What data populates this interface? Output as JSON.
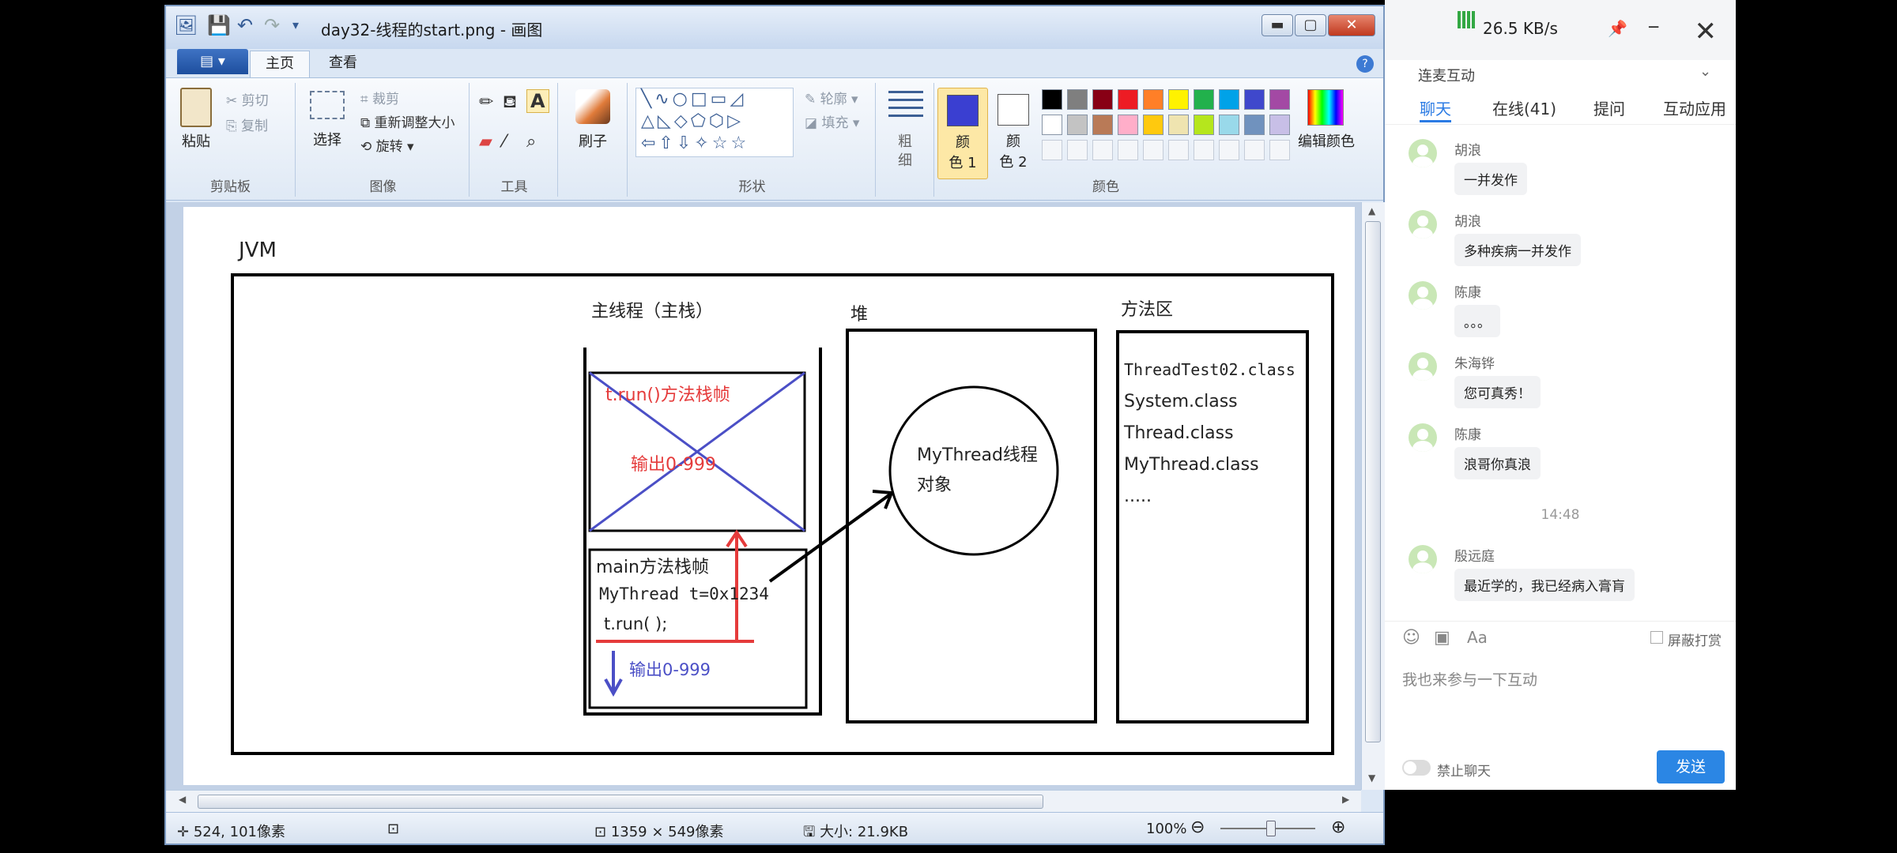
{
  "window": {
    "title": "day32-线程的start.png - 画图",
    "min": "▬",
    "max": "▢",
    "close": "✕"
  },
  "tabs": {
    "file": "▤ ▾",
    "home": "主页",
    "view": "查看",
    "help": "?"
  },
  "ribbon": {
    "clipboard": {
      "paste": "粘贴",
      "cut": "剪切",
      "copy": "复制",
      "label": "剪贴板"
    },
    "image": {
      "select": "选择",
      "crop": "裁剪",
      "resize": "重新调整大小",
      "rotate": "旋转",
      "label": "图像"
    },
    "tools": {
      "label": "工具"
    },
    "brushes": {
      "label": "刷子"
    },
    "shapes": {
      "outline": "轮廓",
      "fill": "填充",
      "label": "形状"
    },
    "size": {
      "line1": "粗",
      "line2": "细"
    },
    "colors": {
      "color1_line1": "颜",
      "color1_line2": "色 1",
      "color2_line1": "颜",
      "color2_line2": "色 2",
      "edit": "编辑颜色",
      "label": "颜色",
      "color1": "#3a3fd1",
      "palette_row1": [
        "#000000",
        "#7f7f7f",
        "#880015",
        "#ed1c24",
        "#ff7f27",
        "#fff200",
        "#22b14c",
        "#00a2e8",
        "#3f48cc",
        "#a349a4"
      ],
      "palette_row2": [
        "#ffffff",
        "#c3c3c3",
        "#b97a57",
        "#ffaec9",
        "#ffc90e",
        "#efe4b0",
        "#b5e61d",
        "#99d9ea",
        "#7092be",
        "#c8bfe7"
      ]
    }
  },
  "diagram": {
    "jvm": "JVM",
    "main_thread": "主线程（主栈）",
    "heap": "堆",
    "method_area": "方法区",
    "run_frame": "t.run()方法栈帧",
    "run_output": "输出0-999",
    "main_frame": "main方法栈帧",
    "decl": "MyThread t=0x1234",
    "call": "t.run( );",
    "main_output": "输出0-999",
    "object_line1": "MyThread线程",
    "object_line2": "对象",
    "classes": [
      "ThreadTest02.class",
      "System.class",
      "Thread.class",
      "MyThread.class",
      "....."
    ]
  },
  "statusbar": {
    "cursor": "524, 101像素",
    "dimensions": "1359 × 549像素",
    "size": "大小: 21.9KB",
    "zoom": "100%"
  },
  "chat": {
    "speed": "26.5 KB/s",
    "close": "✕",
    "mode": "连麦互动",
    "tabs": [
      "聊天",
      "在线(41)",
      "提问",
      "互动应用"
    ],
    "messages": [
      {
        "name": "胡浪",
        "text": "一并发作"
      },
      {
        "name": "胡浪",
        "text": "多种疾病一并发作"
      },
      {
        "name": "陈康",
        "text": "。。。"
      },
      {
        "name": "朱海铧",
        "text": "您可真秀！"
      },
      {
        "name": "陈康",
        "text": "浪哥你真浪"
      },
      {
        "name": "殷远庭",
        "text": "最近学的，我已经病入膏肓"
      }
    ],
    "time": "14:48",
    "block_reward": "屏蔽打赏",
    "input_placeholder": "我也来参与一下互动",
    "mute": "禁止聊天",
    "send": "发送"
  }
}
